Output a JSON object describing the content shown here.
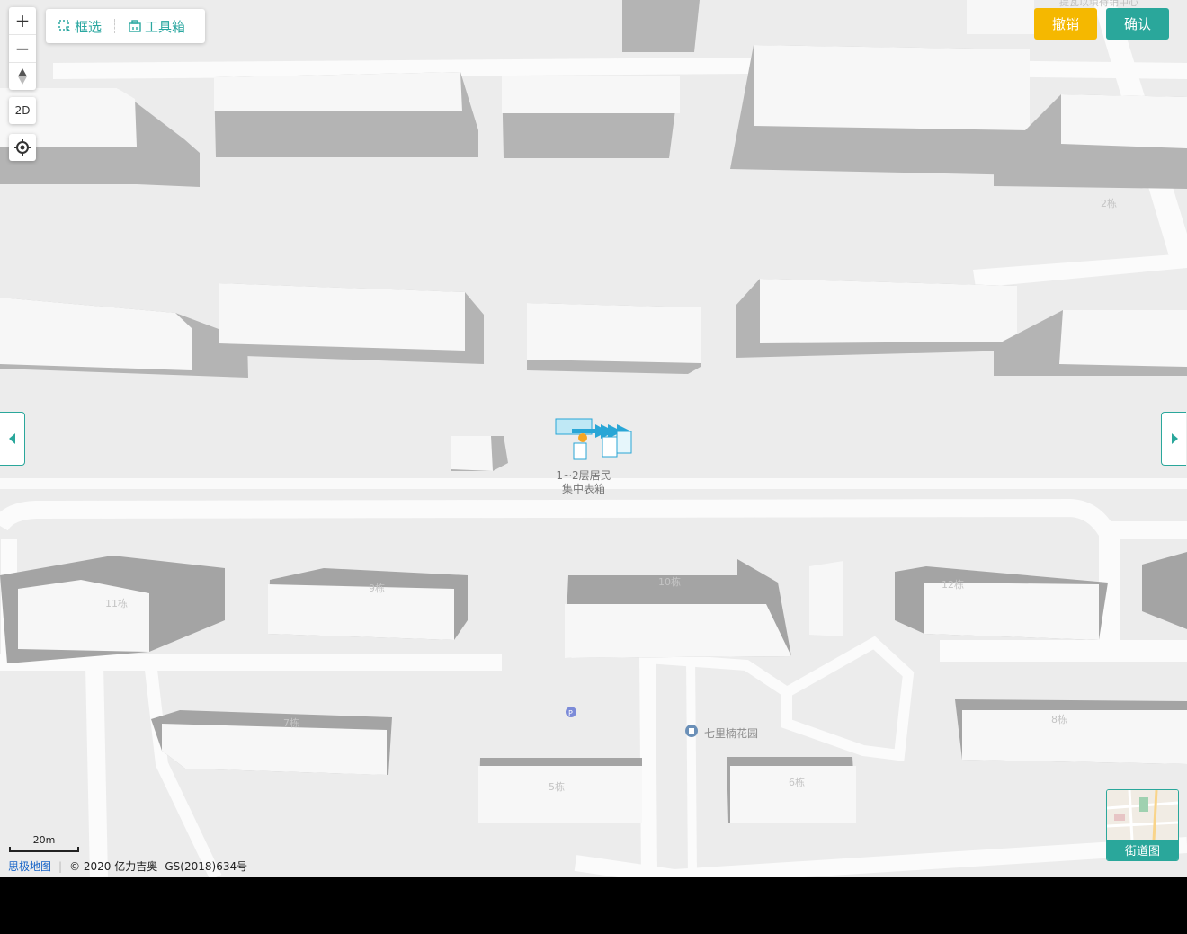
{
  "toolbar": {
    "select_label": "框选",
    "toolbox_label": "工具箱"
  },
  "zoom": {
    "in_label": "+",
    "out_label": "−"
  },
  "controls": {
    "mode_2d_label": "2D"
  },
  "actions": {
    "cancel_label": "撤销",
    "confirm_label": "确认"
  },
  "map": {
    "building_labels": [
      "2栋",
      "11栋",
      "9栋",
      "10栋",
      "12栋",
      "7栋",
      "8栋",
      "5栋",
      "6栋"
    ],
    "poi_garden": "七里楠花园",
    "center_marker_line1": "1~2层居民",
    "center_marker_line2": "集中表箱",
    "top_right_poi": "提瓦以填待销中心"
  },
  "street_view": {
    "label": "街道图"
  },
  "scale": {
    "label": "20m"
  },
  "footer": {
    "brand": "思极地图",
    "copyright": "© 2020 亿力吉奥 -GS(2018)634号"
  },
  "colors": {
    "accent": "#2aa79b",
    "cancel": "#f5b800",
    "marker": "#29a6d6"
  }
}
